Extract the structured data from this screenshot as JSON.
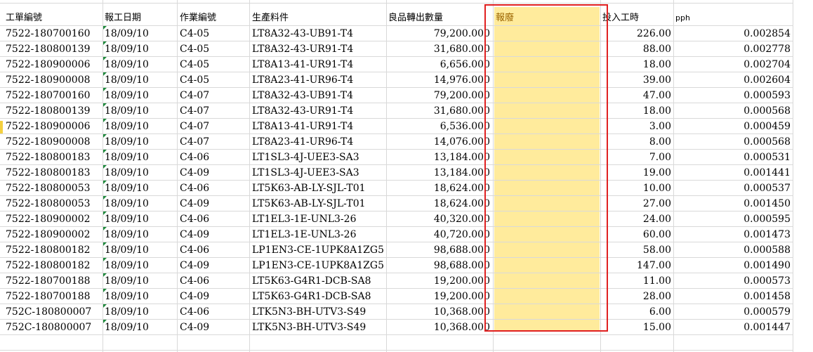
{
  "columns": {
    "work_order": "工單編號",
    "report_date": "報工日期",
    "op_number": "作業編號",
    "product_part": "生產料件",
    "good_qty": "良品轉出數量",
    "scrap": "報廢",
    "input_hours": "投入工時",
    "pph": "pph"
  },
  "rows": [
    {
      "wo": "7522-180700160",
      "date": "18/09/10",
      "op": "C4-05",
      "part": "LT8A32-43-UB91-T4",
      "qty": "79,200.000",
      "hrs": "226.00",
      "pph": "0.002854"
    },
    {
      "wo": "7522-180800139",
      "date": "18/09/10",
      "op": "C4-05",
      "part": "LT8A32-43-UR91-T4",
      "qty": "31,680.000",
      "hrs": "88.00",
      "pph": "0.002778"
    },
    {
      "wo": "7522-180900006",
      "date": "18/09/10",
      "op": "C4-05",
      "part": "LT8A13-41-UR91-T4",
      "qty": "6,656.000",
      "hrs": "18.00",
      "pph": "0.002704"
    },
    {
      "wo": "7522-180900008",
      "date": "18/09/10",
      "op": "C4-05",
      "part": "LT8A23-41-UR96-T4",
      "qty": "14,976.000",
      "hrs": "39.00",
      "pph": "0.002604"
    },
    {
      "wo": "7522-180700160",
      "date": "18/09/10",
      "op": "C4-07",
      "part": "LT8A32-43-UB91-T4",
      "qty": "79,200.000",
      "hrs": "47.00",
      "pph": "0.000593"
    },
    {
      "wo": "7522-180800139",
      "date": "18/09/10",
      "op": "C4-07",
      "part": "LT8A32-43-UR91-T4",
      "qty": "31,680.000",
      "hrs": "18.00",
      "pph": "0.000568"
    },
    {
      "wo": "7522-180900006",
      "date": "18/09/10",
      "op": "C4-07",
      "part": "LT8A13-41-UR91-T4",
      "qty": "6,536.000",
      "hrs": "3.00",
      "pph": "0.000459"
    },
    {
      "wo": "7522-180900008",
      "date": "18/09/10",
      "op": "C4-07",
      "part": "LT8A23-41-UR96-T4",
      "qty": "14,076.000",
      "hrs": "8.00",
      "pph": "0.000568"
    },
    {
      "wo": "7522-180800183",
      "date": "18/09/10",
      "op": "C4-06",
      "part": "LT1SL3-4J-UEE3-SA3",
      "qty": "13,184.000",
      "hrs": "7.00",
      "pph": "0.000531"
    },
    {
      "wo": "7522-180800183",
      "date": "18/09/10",
      "op": "C4-09",
      "part": "LT1SL3-4J-UEE3-SA3",
      "qty": "13,184.000",
      "hrs": "19.00",
      "pph": "0.001441"
    },
    {
      "wo": "7522-180800053",
      "date": "18/09/10",
      "op": "C4-06",
      "part": "LT5K63-AB-LY-SJL-T01",
      "qty": "18,624.000",
      "hrs": "10.00",
      "pph": "0.000537"
    },
    {
      "wo": "7522-180800053",
      "date": "18/09/10",
      "op": "C4-09",
      "part": "LT5K63-AB-LY-SJL-T01",
      "qty": "18,624.000",
      "hrs": "27.00",
      "pph": "0.001450"
    },
    {
      "wo": "7522-180900002",
      "date": "18/09/10",
      "op": "C4-06",
      "part": "LT1EL3-1E-UNL3-26",
      "qty": "40,320.000",
      "hrs": "24.00",
      "pph": "0.000595"
    },
    {
      "wo": "7522-180900002",
      "date": "18/09/10",
      "op": "C4-09",
      "part": "LT1EL3-1E-UNL3-26",
      "qty": "40,720.000",
      "hrs": "60.00",
      "pph": "0.001473"
    },
    {
      "wo": "7522-180800182",
      "date": "18/09/10",
      "op": "C4-06",
      "part": "LP1EN3-CE-1UPK8A1ZG5",
      "qty": "98,688.000",
      "hrs": "58.00",
      "pph": "0.000588"
    },
    {
      "wo": "7522-180800182",
      "date": "18/09/10",
      "op": "C4-09",
      "part": "LP1EN3-CE-1UPK8A1ZG5",
      "qty": "98,688.000",
      "hrs": "147.00",
      "pph": "0.001490"
    },
    {
      "wo": "7522-180700188",
      "date": "18/09/10",
      "op": "C4-06",
      "part": "LT5K63-G4R1-DCB-SA8",
      "qty": "19,200.000",
      "hrs": "11.00",
      "pph": "0.000573"
    },
    {
      "wo": "7522-180700188",
      "date": "18/09/10",
      "op": "C4-09",
      "part": "LT5K63-G4R1-DCB-SA8",
      "qty": "19,200.000",
      "hrs": "28.00",
      "pph": "0.001458"
    },
    {
      "wo": "752C-180800007",
      "date": "18/09/10",
      "op": "C4-06",
      "part": "LTK5N3-BH-UTV3-S49",
      "qty": "10,368.000",
      "hrs": "6.00",
      "pph": "0.000579"
    },
    {
      "wo": "752C-180800007",
      "date": "18/09/10",
      "op": "C4-09",
      "part": "LTK5N3-BH-UTV3-S49",
      "qty": "10,368.000",
      "hrs": "15.00",
      "pph": "0.001447"
    }
  ],
  "colors": {
    "scrap_fill": "#ffeb9c",
    "scrap_text": "#9c6500",
    "highlight_border": "#e02020",
    "text_error_marker": "#1e8a3c"
  }
}
